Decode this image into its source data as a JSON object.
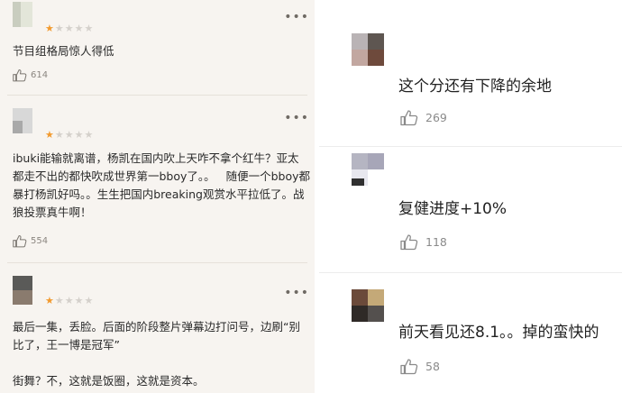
{
  "left_reviews": [
    {
      "stars_filled": 1,
      "stars_total": 5,
      "text": "节目组格局惊人得低",
      "likes": "614"
    },
    {
      "stars_filled": 1,
      "stars_total": 5,
      "text": "ibuki能输就离谱，杨凯在国内吹上天咋不拿个红牛？亚太都走不出的都快吹成世界第一bboy了。。   随便一个bboy都暴打杨凯好吗。。生生把国内breaking观赏水平拉低了。战狼投票真牛啊！",
      "likes": "554"
    },
    {
      "stars_filled": 1,
      "stars_total": 5,
      "text": "最后一集，丢脸。后面的阶段整片弹幕边打问号，边刷“别比了，王一博是冠军”\n\n街舞？不，这就是饭圈，这就是资本。"
    }
  ],
  "right_comments": [
    {
      "text": "这个分还有下降的余地",
      "likes": "269"
    },
    {
      "text": "复健进度+10%",
      "likes": "118"
    },
    {
      "text": "前天看见还8.1。。掉的蛮快的",
      "likes": "58"
    }
  ],
  "icons": {
    "like": "thumbs-up-icon",
    "more": "more-dots-icon",
    "star": "star-icon"
  },
  "colors": {
    "star_active": "#f29a2e",
    "star_inactive": "#d4d0cb"
  }
}
